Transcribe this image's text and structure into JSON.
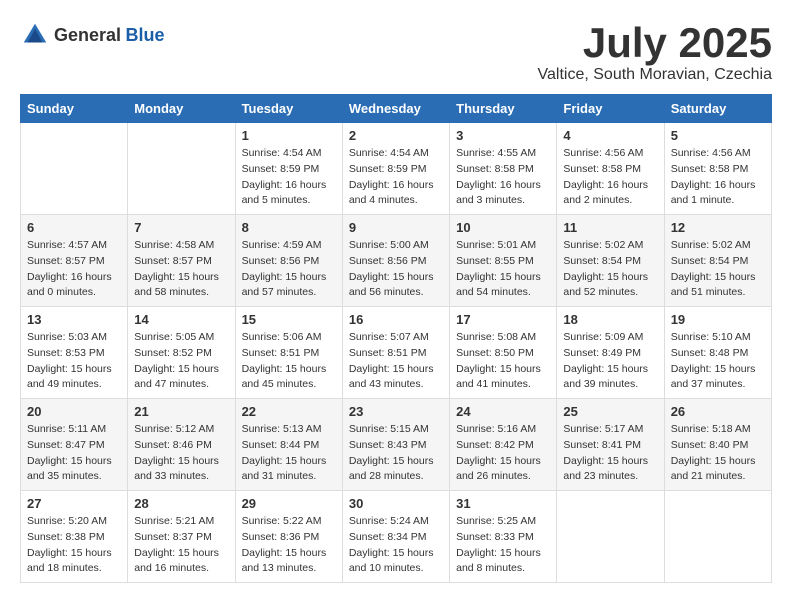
{
  "logo": {
    "general": "General",
    "blue": "Blue"
  },
  "title": "July 2025",
  "subtitle": "Valtice, South Moravian, Czechia",
  "weekdays": [
    "Sunday",
    "Monday",
    "Tuesday",
    "Wednesday",
    "Thursday",
    "Friday",
    "Saturday"
  ],
  "weeks": [
    [
      {
        "day": "",
        "info": ""
      },
      {
        "day": "",
        "info": ""
      },
      {
        "day": "1",
        "info": "Sunrise: 4:54 AM\nSunset: 8:59 PM\nDaylight: 16 hours\nand 5 minutes."
      },
      {
        "day": "2",
        "info": "Sunrise: 4:54 AM\nSunset: 8:59 PM\nDaylight: 16 hours\nand 4 minutes."
      },
      {
        "day": "3",
        "info": "Sunrise: 4:55 AM\nSunset: 8:58 PM\nDaylight: 16 hours\nand 3 minutes."
      },
      {
        "day": "4",
        "info": "Sunrise: 4:56 AM\nSunset: 8:58 PM\nDaylight: 16 hours\nand 2 minutes."
      },
      {
        "day": "5",
        "info": "Sunrise: 4:56 AM\nSunset: 8:58 PM\nDaylight: 16 hours\nand 1 minute."
      }
    ],
    [
      {
        "day": "6",
        "info": "Sunrise: 4:57 AM\nSunset: 8:57 PM\nDaylight: 16 hours\nand 0 minutes."
      },
      {
        "day": "7",
        "info": "Sunrise: 4:58 AM\nSunset: 8:57 PM\nDaylight: 15 hours\nand 58 minutes."
      },
      {
        "day": "8",
        "info": "Sunrise: 4:59 AM\nSunset: 8:56 PM\nDaylight: 15 hours\nand 57 minutes."
      },
      {
        "day": "9",
        "info": "Sunrise: 5:00 AM\nSunset: 8:56 PM\nDaylight: 15 hours\nand 56 minutes."
      },
      {
        "day": "10",
        "info": "Sunrise: 5:01 AM\nSunset: 8:55 PM\nDaylight: 15 hours\nand 54 minutes."
      },
      {
        "day": "11",
        "info": "Sunrise: 5:02 AM\nSunset: 8:54 PM\nDaylight: 15 hours\nand 52 minutes."
      },
      {
        "day": "12",
        "info": "Sunrise: 5:02 AM\nSunset: 8:54 PM\nDaylight: 15 hours\nand 51 minutes."
      }
    ],
    [
      {
        "day": "13",
        "info": "Sunrise: 5:03 AM\nSunset: 8:53 PM\nDaylight: 15 hours\nand 49 minutes."
      },
      {
        "day": "14",
        "info": "Sunrise: 5:05 AM\nSunset: 8:52 PM\nDaylight: 15 hours\nand 47 minutes."
      },
      {
        "day": "15",
        "info": "Sunrise: 5:06 AM\nSunset: 8:51 PM\nDaylight: 15 hours\nand 45 minutes."
      },
      {
        "day": "16",
        "info": "Sunrise: 5:07 AM\nSunset: 8:51 PM\nDaylight: 15 hours\nand 43 minutes."
      },
      {
        "day": "17",
        "info": "Sunrise: 5:08 AM\nSunset: 8:50 PM\nDaylight: 15 hours\nand 41 minutes."
      },
      {
        "day": "18",
        "info": "Sunrise: 5:09 AM\nSunset: 8:49 PM\nDaylight: 15 hours\nand 39 minutes."
      },
      {
        "day": "19",
        "info": "Sunrise: 5:10 AM\nSunset: 8:48 PM\nDaylight: 15 hours\nand 37 minutes."
      }
    ],
    [
      {
        "day": "20",
        "info": "Sunrise: 5:11 AM\nSunset: 8:47 PM\nDaylight: 15 hours\nand 35 minutes."
      },
      {
        "day": "21",
        "info": "Sunrise: 5:12 AM\nSunset: 8:46 PM\nDaylight: 15 hours\nand 33 minutes."
      },
      {
        "day": "22",
        "info": "Sunrise: 5:13 AM\nSunset: 8:44 PM\nDaylight: 15 hours\nand 31 minutes."
      },
      {
        "day": "23",
        "info": "Sunrise: 5:15 AM\nSunset: 8:43 PM\nDaylight: 15 hours\nand 28 minutes."
      },
      {
        "day": "24",
        "info": "Sunrise: 5:16 AM\nSunset: 8:42 PM\nDaylight: 15 hours\nand 26 minutes."
      },
      {
        "day": "25",
        "info": "Sunrise: 5:17 AM\nSunset: 8:41 PM\nDaylight: 15 hours\nand 23 minutes."
      },
      {
        "day": "26",
        "info": "Sunrise: 5:18 AM\nSunset: 8:40 PM\nDaylight: 15 hours\nand 21 minutes."
      }
    ],
    [
      {
        "day": "27",
        "info": "Sunrise: 5:20 AM\nSunset: 8:38 PM\nDaylight: 15 hours\nand 18 minutes."
      },
      {
        "day": "28",
        "info": "Sunrise: 5:21 AM\nSunset: 8:37 PM\nDaylight: 15 hours\nand 16 minutes."
      },
      {
        "day": "29",
        "info": "Sunrise: 5:22 AM\nSunset: 8:36 PM\nDaylight: 15 hours\nand 13 minutes."
      },
      {
        "day": "30",
        "info": "Sunrise: 5:24 AM\nSunset: 8:34 PM\nDaylight: 15 hours\nand 10 minutes."
      },
      {
        "day": "31",
        "info": "Sunrise: 5:25 AM\nSunset: 8:33 PM\nDaylight: 15 hours\nand 8 minutes."
      },
      {
        "day": "",
        "info": ""
      },
      {
        "day": "",
        "info": ""
      }
    ]
  ]
}
